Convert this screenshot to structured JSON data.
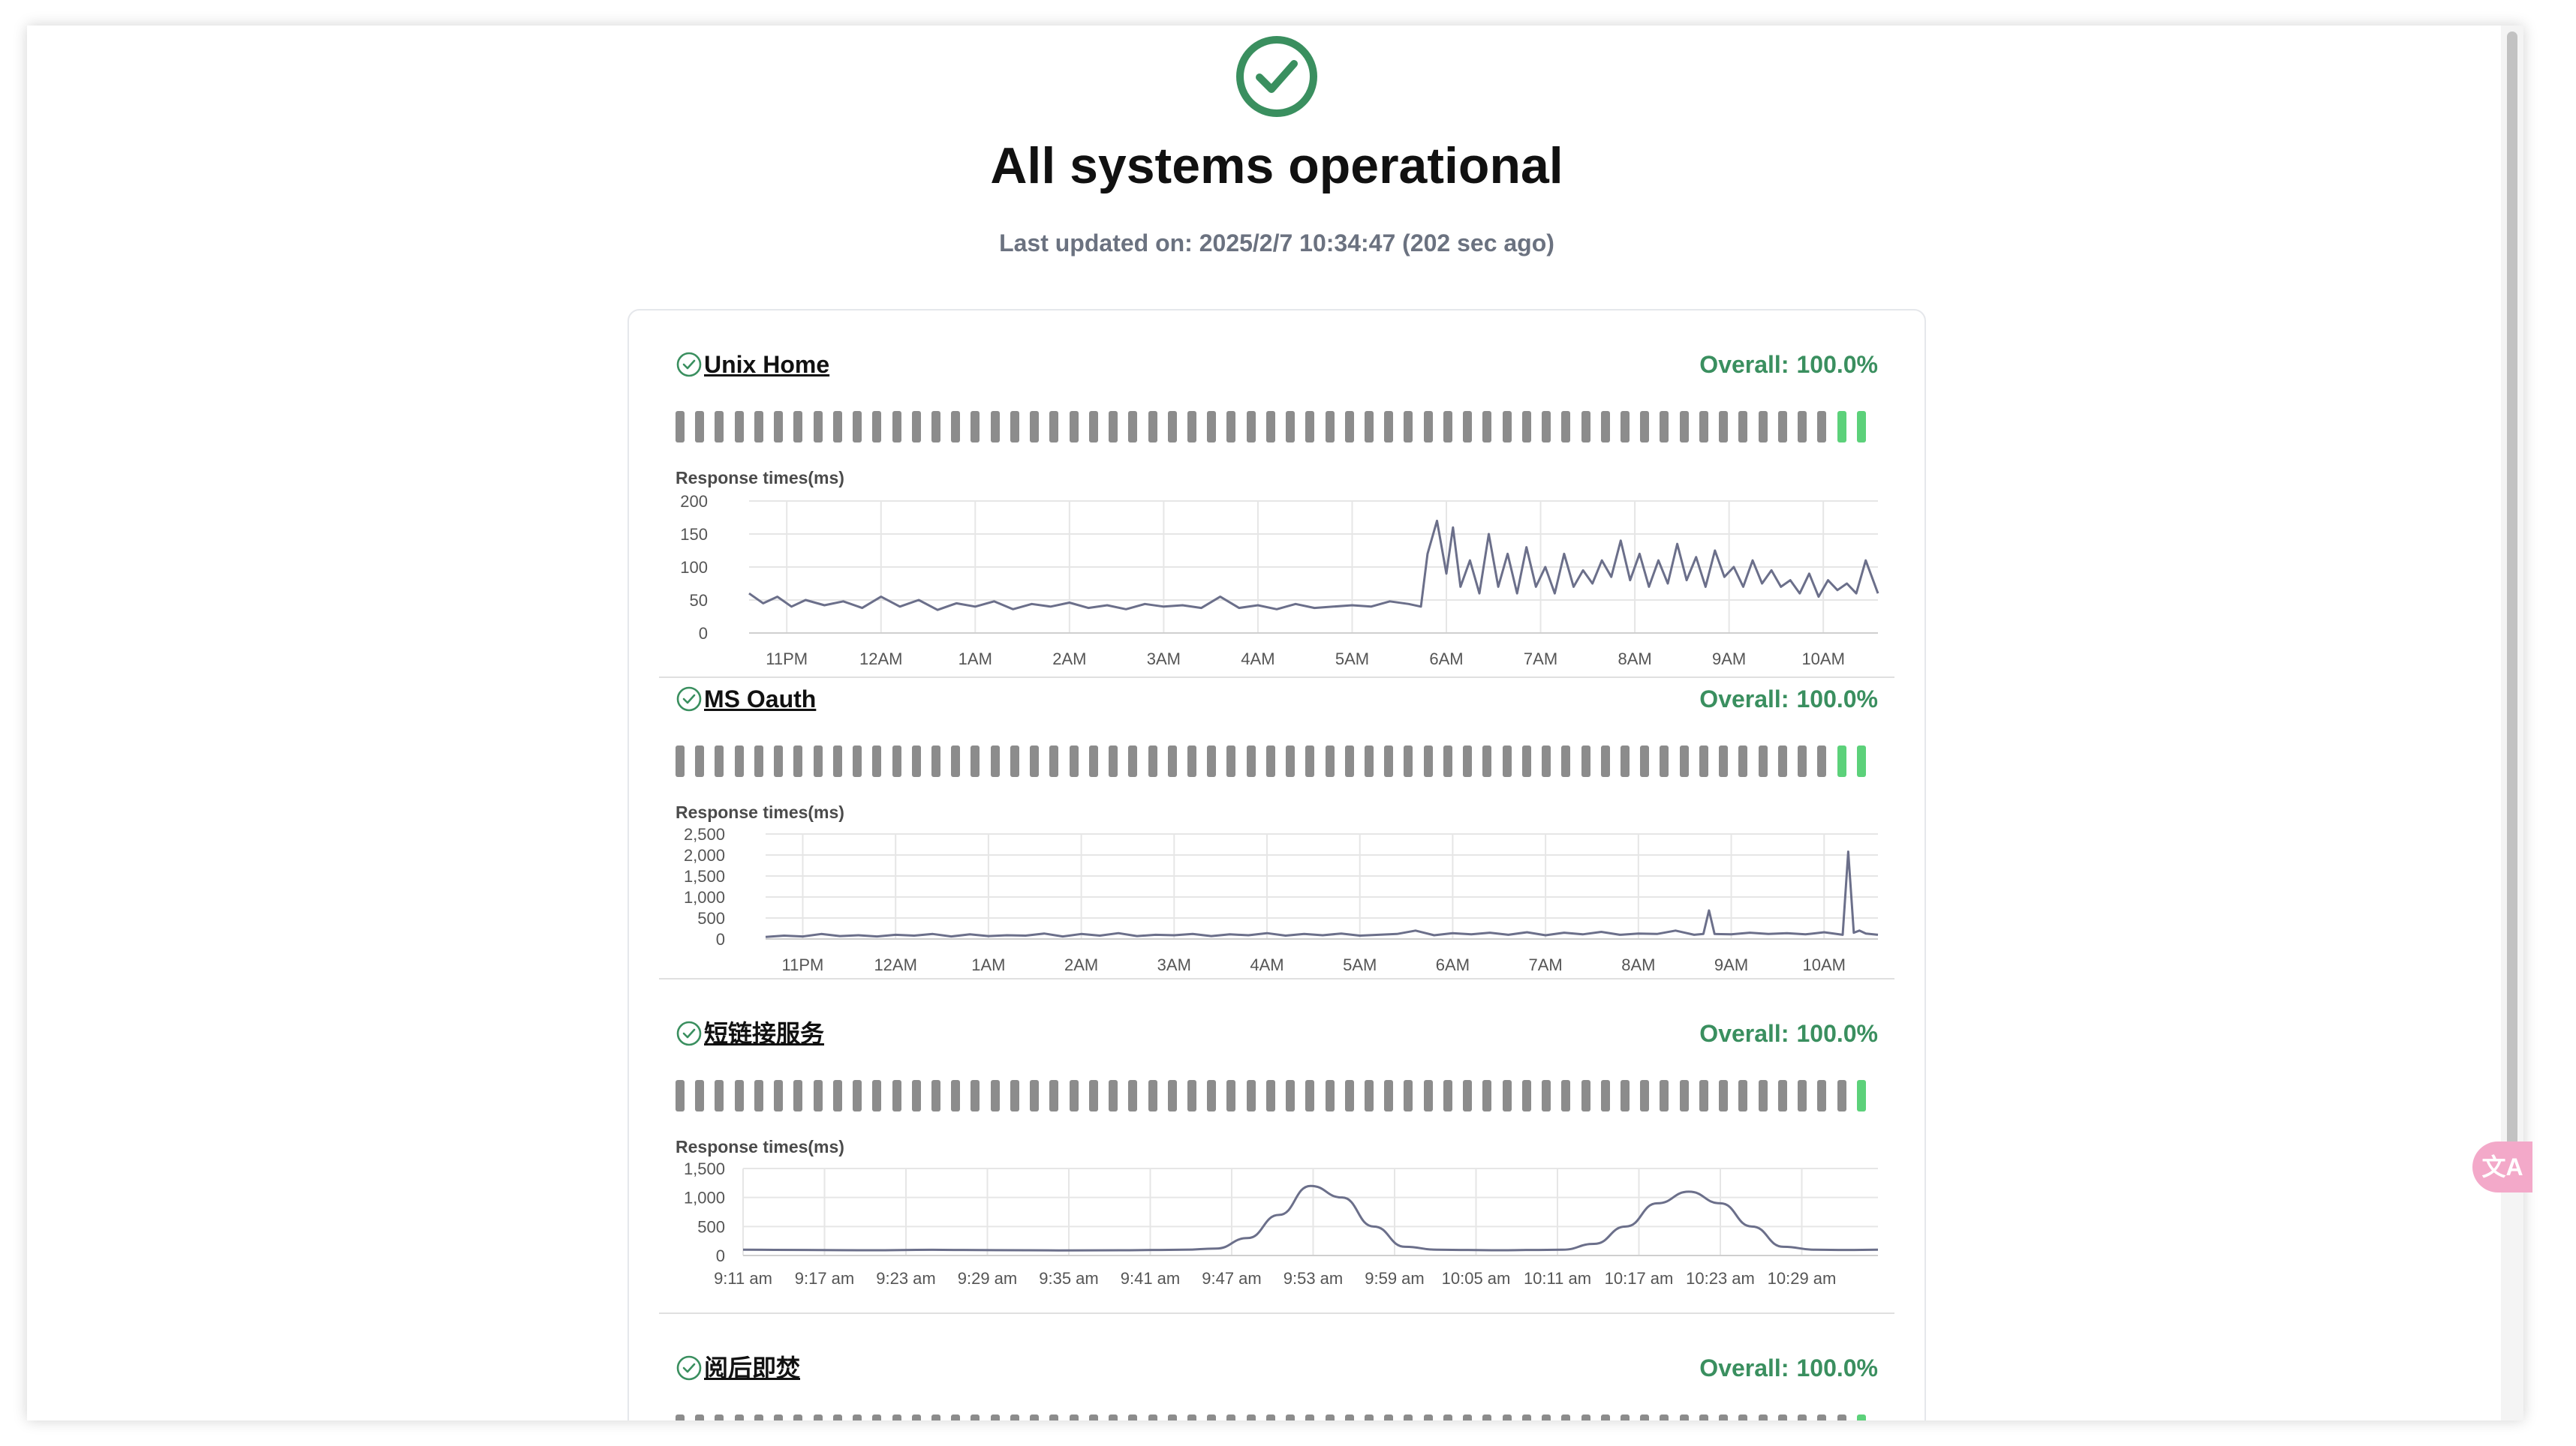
{
  "page": {
    "title": "All systems operational",
    "last_updated": "Last updated on: 2025/2/7 10:34:47 (202 sec ago)"
  },
  "colors": {
    "operational": "#3a8f5f",
    "beat_past": "#8c8c8c",
    "beat_up": "#5cd17a",
    "line": "#6b6f8a"
  },
  "icons": {
    "status": "check-circle-icon",
    "monitor": "check-circle-outline-icon",
    "translate": "translate-icon"
  },
  "translate_label": "文A",
  "monitors": [
    {
      "name": "Unix Home",
      "overall_label": "Overall:",
      "overall_value": "100.0%",
      "heartbeats": {
        "total": 61,
        "up_recent": 2
      },
      "chart_title": "Response times(ms)",
      "chart_data": {
        "type": "line",
        "ylim": [
          0,
          200
        ],
        "yticks": [
          0,
          50,
          100,
          150,
          200
        ],
        "ytick_labels": [
          "0",
          "50",
          "100",
          "150",
          "200"
        ],
        "xlim": [
          22.6,
          34.58
        ],
        "xticks": [
          23,
          24,
          25,
          26,
          27,
          28,
          29,
          30,
          31,
          32,
          33,
          34
        ],
        "xtick_labels": [
          "11PM",
          "12AM",
          "1AM",
          "2AM",
          "3AM",
          "4AM",
          "5AM",
          "6AM",
          "7AM",
          "8AM",
          "9AM",
          "10AM"
        ],
        "x": [
          22.6,
          22.75,
          22.9,
          23.05,
          23.2,
          23.4,
          23.6,
          23.8,
          24.0,
          24.2,
          24.4,
          24.6,
          24.8,
          25.0,
          25.2,
          25.4,
          25.6,
          25.8,
          26.0,
          26.2,
          26.4,
          26.6,
          26.8,
          27.0,
          27.2,
          27.4,
          27.6,
          27.8,
          28.0,
          28.2,
          28.4,
          28.6,
          28.8,
          29.0,
          29.2,
          29.4,
          29.6,
          29.73,
          29.8,
          29.9,
          30.0,
          30.07,
          30.15,
          30.25,
          30.35,
          30.45,
          30.55,
          30.65,
          30.75,
          30.85,
          30.95,
          31.05,
          31.15,
          31.25,
          31.35,
          31.45,
          31.55,
          31.65,
          31.75,
          31.85,
          31.95,
          32.05,
          32.15,
          32.25,
          32.35,
          32.45,
          32.55,
          32.65,
          32.75,
          32.85,
          32.95,
          33.05,
          33.15,
          33.25,
          33.35,
          33.45,
          33.55,
          33.65,
          33.75,
          33.85,
          33.95,
          34.05,
          34.15,
          34.25,
          34.35,
          34.45,
          34.58
        ],
        "y": [
          60,
          45,
          55,
          40,
          50,
          42,
          48,
          38,
          55,
          40,
          50,
          35,
          45,
          40,
          48,
          36,
          44,
          40,
          46,
          38,
          42,
          36,
          44,
          40,
          42,
          38,
          55,
          38,
          42,
          36,
          44,
          38,
          40,
          42,
          40,
          48,
          44,
          40,
          120,
          170,
          90,
          160,
          70,
          110,
          60,
          150,
          70,
          120,
          60,
          130,
          70,
          100,
          60,
          120,
          70,
          95,
          75,
          110,
          85,
          140,
          80,
          120,
          70,
          110,
          75,
          135,
          80,
          115,
          70,
          125,
          85,
          100,
          70,
          110,
          75,
          95,
          70,
          80,
          60,
          90,
          55,
          80,
          65,
          75,
          60,
          110,
          60
        ]
      }
    },
    {
      "name": "MS Oauth",
      "overall_label": "Overall:",
      "overall_value": "100.0%",
      "heartbeats": {
        "total": 61,
        "up_recent": 2
      },
      "chart_title": "Response times(ms)",
      "chart_data": {
        "type": "line",
        "ylim": [
          0,
          2500
        ],
        "yticks": [
          0,
          500,
          1000,
          1500,
          2000,
          2500
        ],
        "ytick_labels": [
          "0",
          "500",
          "1,000",
          "1,500",
          "2,000",
          "2,500"
        ],
        "xlim": [
          22.6,
          34.58
        ],
        "xticks": [
          23,
          24,
          25,
          26,
          27,
          28,
          29,
          30,
          31,
          32,
          33,
          34
        ],
        "xtick_labels": [
          "11PM",
          "12AM",
          "1AM",
          "2AM",
          "3AM",
          "4AM",
          "5AM",
          "6AM",
          "7AM",
          "8AM",
          "9AM",
          "10AM"
        ],
        "x": [
          22.6,
          22.8,
          23.0,
          23.2,
          23.4,
          23.6,
          23.8,
          24.0,
          24.2,
          24.4,
          24.6,
          24.8,
          25.0,
          25.2,
          25.4,
          25.6,
          25.8,
          26.0,
          26.2,
          26.4,
          26.6,
          26.8,
          27.0,
          27.2,
          27.4,
          27.6,
          27.8,
          28.0,
          28.2,
          28.4,
          28.6,
          28.8,
          29.0,
          29.2,
          29.4,
          29.6,
          29.8,
          30.0,
          30.2,
          30.4,
          30.6,
          30.8,
          31.0,
          31.2,
          31.4,
          31.6,
          31.8,
          32.0,
          32.2,
          32.4,
          32.6,
          32.7,
          32.76,
          32.82,
          33.0,
          33.2,
          33.4,
          33.6,
          33.8,
          34.0,
          34.2,
          34.26,
          34.32,
          34.38,
          34.45,
          34.58
        ],
        "y": [
          50,
          80,
          60,
          120,
          70,
          90,
          60,
          100,
          80,
          120,
          60,
          110,
          70,
          90,
          80,
          130,
          60,
          120,
          80,
          140,
          70,
          100,
          90,
          120,
          70,
          110,
          90,
          140,
          80,
          120,
          90,
          130,
          80,
          100,
          120,
          200,
          90,
          140,
          110,
          150,
          100,
          160,
          90,
          150,
          110,
          170,
          100,
          130,
          120,
          200,
          100,
          120,
          680,
          120,
          110,
          150,
          120,
          140,
          110,
          160,
          100,
          2080,
          150,
          200,
          130,
          100
        ]
      }
    },
    {
      "name": "短链接服务",
      "overall_label": "Overall:",
      "overall_value": "100.0%",
      "heartbeats": {
        "total": 61,
        "up_recent": 1
      },
      "chart_title": "Response times(ms)",
      "chart_data": {
        "type": "line",
        "ylim": [
          0,
          1500
        ],
        "yticks": [
          0,
          500,
          1000,
          1500
        ],
        "ytick_labels": [
          "0",
          "500",
          "1,000",
          "1,500"
        ],
        "xlim": [
          551,
          587
        ],
        "xticks": [
          551,
          557,
          563,
          569,
          575,
          581,
          587,
          593,
          599,
          605,
          611,
          617,
          623,
          629
        ],
        "xtick_labels": [
          "9:11 am",
          "9:17 am",
          "9:23 am",
          "9:29 am",
          "9:35 am",
          "9:41 am",
          "9:47 am",
          "9:53 am",
          "9:59 am",
          "10:05 am",
          "10:11 am",
          "10:17 am",
          "10:23 am",
          "10:29 am"
        ],
        "x": [
          551,
          553,
          555,
          557,
          559,
          561,
          563,
          564,
          565,
          566,
          567,
          568,
          569,
          570,
          571,
          572,
          573,
          574,
          575,
          576,
          577,
          578,
          579,
          580,
          581,
          582,
          583,
          584,
          585,
          586,
          587
        ],
        "y": [
          100,
          95,
          90,
          98,
          92,
          88,
          90,
          95,
          100,
          120,
          300,
          700,
          1200,
          1000,
          500,
          150,
          100,
          95,
          90,
          95,
          100,
          200,
          500,
          900,
          1100,
          900,
          500,
          150,
          100,
          95,
          100
        ]
      }
    },
    {
      "name": "阅后即焚",
      "overall_label": "Overall:",
      "overall_value": "100.0%",
      "heartbeats": {
        "total": 61,
        "up_recent": 1
      }
    }
  ]
}
